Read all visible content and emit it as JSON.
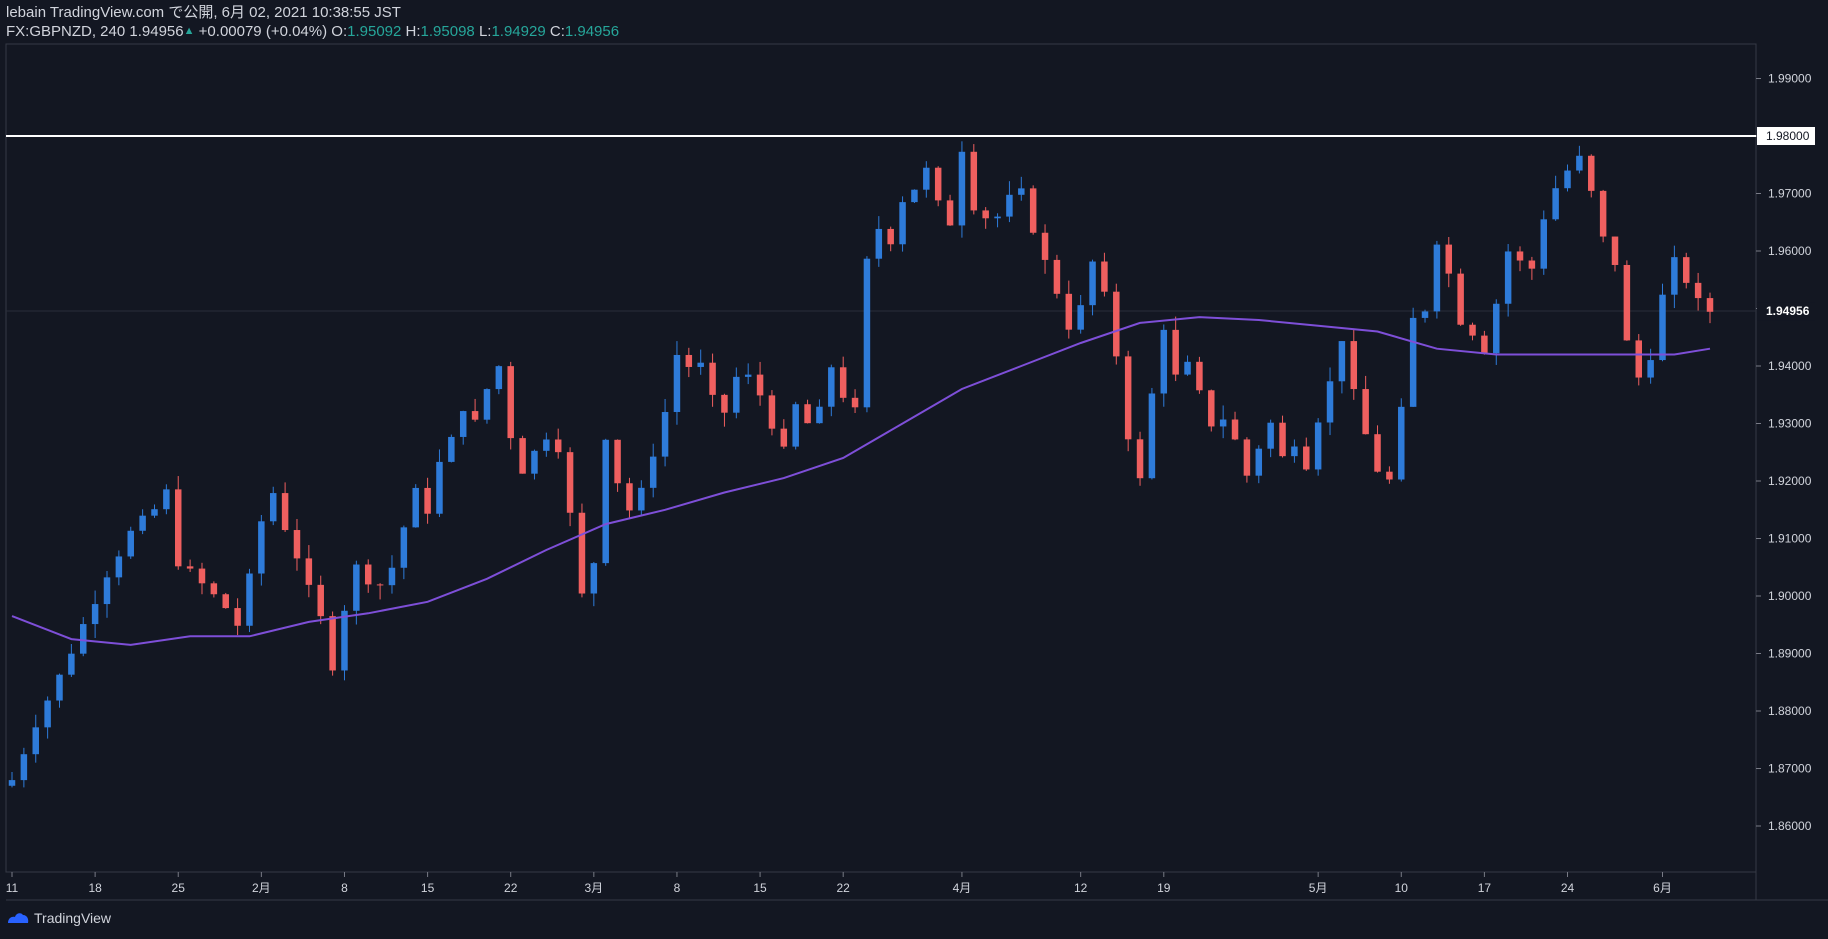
{
  "header": {
    "published_line": "lebain TradingView.com で公開, 6月 02, 2021 10:38:55 JST",
    "symbol_interval": "FX:GBPNZD, 240",
    "last_price": "1.94956",
    "change": "+0.00079 (+0.04%)",
    "open_label": "O:",
    "open": "1.95092",
    "high_label": "H:",
    "high": "1.95098",
    "low_label": "L:",
    "low": "1.94929",
    "close_label": "C:",
    "close": "1.94956"
  },
  "footer": {
    "brand": "TradingView"
  },
  "colors": {
    "background": "#131722",
    "up": "#2e7bd9",
    "down": "#ef5f5f",
    "ma": "#7e4fd8",
    "hline": "#ffffff",
    "grid_text": "#d1d4dc",
    "accent_green": "#26a69a"
  },
  "chart_data": {
    "type": "candlestick",
    "symbol": "FX:GBPNZD",
    "interval": "240",
    "ylim": [
      1.852,
      1.996
    ],
    "y_ticks": [
      "1.99000",
      "1.98000",
      "1.97000",
      "1.96000",
      "1.95000",
      "1.94000",
      "1.93000",
      "1.92000",
      "1.91000",
      "1.90000",
      "1.89000",
      "1.88000",
      "1.87000",
      "1.86000"
    ],
    "x_ticks": [
      "11",
      "18",
      "25",
      "2月",
      "8",
      "15",
      "22",
      "3月",
      "8",
      "15",
      "22",
      "4月",
      "12",
      "19",
      "5月",
      "10",
      "17",
      "24",
      "6月"
    ],
    "x_tick_index": [
      0,
      7,
      14,
      21,
      28,
      35,
      42,
      49,
      56,
      63,
      70,
      80,
      90,
      97,
      110,
      117,
      124,
      131,
      139
    ],
    "horizontal_line": {
      "value": 1.98,
      "label": "1.98000"
    },
    "last_price_label": "1.94956",
    "last_price_value": 1.94956,
    "close_path": [
      [
        0,
        1.868
      ],
      [
        2,
        1.878
      ],
      [
        4,
        1.886
      ],
      [
        6,
        1.895
      ],
      [
        8,
        1.904
      ],
      [
        10,
        1.911
      ],
      [
        12,
        1.915
      ],
      [
        13,
        1.918
      ],
      [
        14,
        1.906
      ],
      [
        16,
        1.902
      ],
      [
        18,
        1.898
      ],
      [
        19,
        1.895
      ],
      [
        20,
        1.903
      ],
      [
        21,
        1.913
      ],
      [
        22,
        1.918
      ],
      [
        23,
        1.912
      ],
      [
        24,
        1.907
      ],
      [
        25,
        1.901
      ],
      [
        26,
        1.896
      ],
      [
        27,
        1.888
      ],
      [
        28,
        1.898
      ],
      [
        29,
        1.905
      ],
      [
        30,
        1.903
      ],
      [
        31,
        1.902
      ],
      [
        32,
        1.905
      ],
      [
        33,
        1.912
      ],
      [
        34,
        1.918
      ],
      [
        35,
        1.915
      ],
      [
        36,
        1.923
      ],
      [
        37,
        1.927
      ],
      [
        38,
        1.933
      ],
      [
        39,
        1.93
      ],
      [
        40,
        1.936
      ],
      [
        41,
        1.94
      ],
      [
        42,
        1.928
      ],
      [
        43,
        1.922
      ],
      [
        44,
        1.925
      ],
      [
        45,
        1.928
      ],
      [
        46,
        1.926
      ],
      [
        47,
        1.914
      ],
      [
        48,
        1.9
      ],
      [
        49,
        1.906
      ],
      [
        50,
        1.928
      ],
      [
        51,
        1.92
      ],
      [
        52,
        1.915
      ],
      [
        53,
        1.918
      ],
      [
        54,
        1.925
      ],
      [
        55,
        1.932
      ],
      [
        56,
        1.942
      ],
      [
        57,
        1.94
      ],
      [
        58,
        1.94
      ],
      [
        59,
        1.934
      ],
      [
        60,
        1.932
      ],
      [
        61,
        1.938
      ],
      [
        62,
        1.938
      ],
      [
        63,
        1.935
      ],
      [
        64,
        1.93
      ],
      [
        65,
        1.925
      ],
      [
        66,
        1.933
      ],
      [
        67,
        1.93
      ],
      [
        68,
        1.932
      ],
      [
        69,
        1.94
      ],
      [
        70,
        1.935
      ],
      [
        71,
        1.932
      ],
      [
        72,
        1.958
      ],
      [
        73,
        1.964
      ],
      [
        74,
        1.962
      ],
      [
        75,
        1.969
      ],
      [
        76,
        1.971
      ],
      [
        77,
        1.974
      ],
      [
        78,
        1.968
      ],
      [
        79,
        1.965
      ],
      [
        80,
        1.978
      ],
      [
        81,
        1.968
      ],
      [
        82,
        1.966
      ],
      [
        83,
        1.966
      ],
      [
        84,
        1.969
      ],
      [
        85,
        1.97
      ],
      [
        86,
        1.964
      ],
      [
        87,
        1.958
      ],
      [
        88,
        1.953
      ],
      [
        89,
        1.947
      ],
      [
        90,
        1.95
      ],
      [
        91,
        1.958
      ],
      [
        92,
        1.952
      ],
      [
        93,
        1.942
      ],
      [
        94,
        1.928
      ],
      [
        95,
        1.92
      ],
      [
        96,
        1.935
      ],
      [
        97,
        1.947
      ],
      [
        98,
        1.938
      ],
      [
        99,
        1.94
      ],
      [
        100,
        1.935
      ],
      [
        101,
        1.93
      ],
      [
        102,
        1.931
      ],
      [
        103,
        1.927
      ],
      [
        104,
        1.921
      ],
      [
        105,
        1.926
      ],
      [
        106,
        1.93
      ],
      [
        107,
        1.924
      ],
      [
        108,
        1.927
      ],
      [
        109,
        1.923
      ],
      [
        110,
        1.931
      ],
      [
        111,
        1.937
      ],
      [
        112,
        1.945
      ],
      [
        113,
        1.935
      ],
      [
        114,
        1.928
      ],
      [
        115,
        1.922
      ],
      [
        116,
        1.92
      ],
      [
        117,
        1.932
      ],
      [
        118,
        1.948
      ],
      [
        119,
        1.95
      ],
      [
        120,
        1.962
      ],
      [
        121,
        1.956
      ],
      [
        122,
        1.948
      ],
      [
        123,
        1.946
      ],
      [
        124,
        1.943
      ],
      [
        125,
        1.951
      ],
      [
        126,
        1.96
      ],
      [
        127,
        1.958
      ],
      [
        128,
        1.957
      ],
      [
        129,
        1.966
      ],
      [
        130,
        1.971
      ],
      [
        131,
        1.974
      ],
      [
        132,
        1.976
      ],
      [
        133,
        1.97
      ],
      [
        134,
        1.962
      ],
      [
        135,
        1.958
      ],
      [
        136,
        1.944
      ],
      [
        137,
        1.938
      ],
      [
        138,
        1.942
      ],
      [
        139,
        1.952
      ],
      [
        140,
        1.958
      ],
      [
        141,
        1.955
      ],
      [
        142,
        1.951
      ],
      [
        143,
        1.9496
      ]
    ],
    "ma_line": [
      [
        0,
        1.8965
      ],
      [
        5,
        1.8925
      ],
      [
        10,
        1.8915
      ],
      [
        15,
        1.893
      ],
      [
        20,
        1.893
      ],
      [
        25,
        1.8955
      ],
      [
        30,
        1.897
      ],
      [
        35,
        1.899
      ],
      [
        40,
        1.903
      ],
      [
        45,
        1.908
      ],
      [
        50,
        1.9125
      ],
      [
        55,
        1.915
      ],
      [
        60,
        1.918
      ],
      [
        65,
        1.9205
      ],
      [
        70,
        1.924
      ],
      [
        75,
        1.93
      ],
      [
        80,
        1.936
      ],
      [
        85,
        1.94
      ],
      [
        90,
        1.944
      ],
      [
        95,
        1.9475
      ],
      [
        100,
        1.9485
      ],
      [
        105,
        1.948
      ],
      [
        110,
        1.947
      ],
      [
        115,
        1.946
      ],
      [
        120,
        1.943
      ],
      [
        125,
        1.942
      ],
      [
        130,
        1.942
      ],
      [
        135,
        1.942
      ],
      [
        140,
        1.942
      ],
      [
        143,
        1.943
      ]
    ]
  }
}
